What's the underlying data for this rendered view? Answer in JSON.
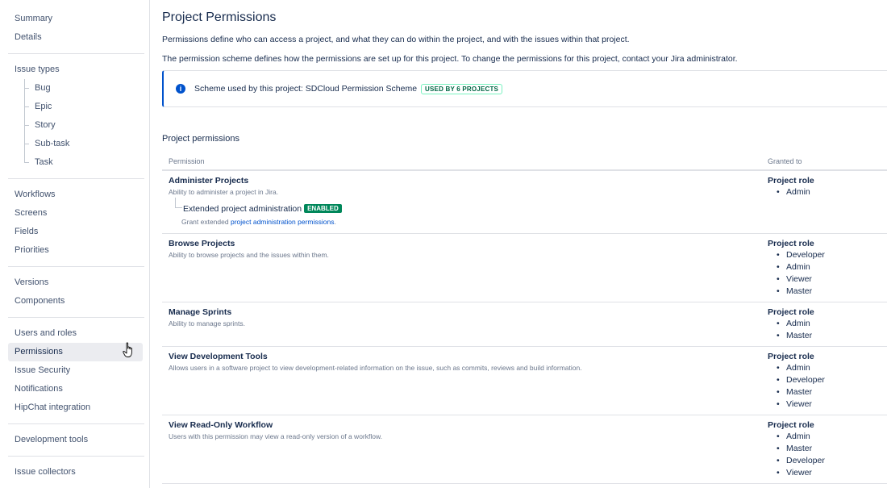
{
  "sidebar": {
    "groups": [
      [
        "Summary",
        "Details"
      ],
      [
        "Issue types"
      ],
      [
        "Workflows",
        "Screens",
        "Fields",
        "Priorities"
      ],
      [
        "Versions",
        "Components"
      ],
      [
        "Users and roles",
        "Permissions",
        "Issue Security",
        "Notifications",
        "HipChat integration"
      ],
      [
        "Development tools"
      ],
      [
        "Issue collectors"
      ]
    ],
    "issue_types": [
      "Bug",
      "Epic",
      "Story",
      "Sub-task",
      "Task"
    ],
    "active": "Permissions"
  },
  "page": {
    "title": "Project Permissions",
    "desc1": "Permissions define who can access a project, and what they can do within the project, and with the issues within that project.",
    "desc2": "The permission scheme defines how the permissions are set up for this project. To change the permissions for this project, contact your Jira administrator."
  },
  "scheme": {
    "label": "Scheme used by this project: SDCloud Permission Scheme",
    "badge": "USED BY 6 PROJECTS",
    "icon": "info-icon"
  },
  "section_title": "Project permissions",
  "table": {
    "col_permission": "Permission",
    "col_granted": "Granted to",
    "rows": [
      {
        "name": "Administer Projects",
        "desc": "Ability to administer a project in Jira.",
        "extended": {
          "title": "Extended project administration",
          "badge": "ENABLED",
          "desc_prefix": "Grant extended ",
          "link": "project administration permissions",
          "desc_suffix": "."
        },
        "grant_title": "Project role",
        "roles": [
          "Admin"
        ]
      },
      {
        "name": "Browse Projects",
        "desc": "Ability to browse projects and the issues within them.",
        "grant_title": "Project role",
        "roles": [
          "Developer",
          "Admin",
          "Viewer",
          "Master"
        ]
      },
      {
        "name": "Manage Sprints",
        "desc": "Ability to manage sprints.",
        "grant_title": "Project role",
        "roles": [
          "Admin",
          "Master"
        ]
      },
      {
        "name": "View Development Tools",
        "desc": "Allows users in a software project to view development-related information on the issue, such as commits, reviews and build information.",
        "grant_title": "Project role",
        "roles": [
          "Admin",
          "Developer",
          "Master",
          "Viewer"
        ]
      },
      {
        "name": "View Read-Only Workflow",
        "desc": "Users with this permission may view a read-only version of a workflow.",
        "grant_title": "Project role",
        "roles": [
          "Admin",
          "Master",
          "Developer",
          "Viewer"
        ]
      }
    ]
  },
  "colors": {
    "accent": "#0052cc",
    "enabled_green": "#00875a",
    "text": "#172b4d",
    "muted": "#6b778c"
  }
}
